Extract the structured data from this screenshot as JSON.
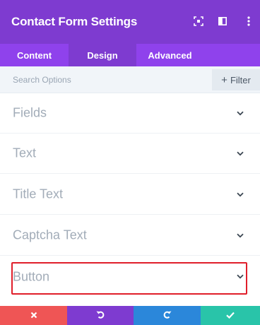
{
  "header": {
    "title": "Contact Form Settings",
    "icons": [
      "expand-icon",
      "layout-icon",
      "more-icon"
    ]
  },
  "tabs": [
    {
      "label": "Content",
      "active": false
    },
    {
      "label": "Design",
      "active": true
    },
    {
      "label": "Advanced",
      "active": false
    }
  ],
  "search": {
    "placeholder": "Search Options",
    "filter_label": "Filter",
    "filter_icon": "plus-icon"
  },
  "sections": [
    {
      "label": "Fields"
    },
    {
      "label": "Text"
    },
    {
      "label": "Title Text"
    },
    {
      "label": "Captcha Text"
    },
    {
      "label": "Button",
      "highlighted": true
    }
  ],
  "footer": {
    "buttons": [
      {
        "name": "cancel",
        "icon": "close-icon",
        "color": "#ef5555"
      },
      {
        "name": "undo",
        "icon": "undo-icon",
        "color": "#7e3bd0"
      },
      {
        "name": "redo",
        "icon": "redo-icon",
        "color": "#2b87da"
      },
      {
        "name": "save",
        "icon": "check-icon",
        "color": "#29c4a9"
      }
    ]
  },
  "colors": {
    "header": "#7e3bd0",
    "tabs": "#8f42ec",
    "highlight": "#e01e2a"
  }
}
